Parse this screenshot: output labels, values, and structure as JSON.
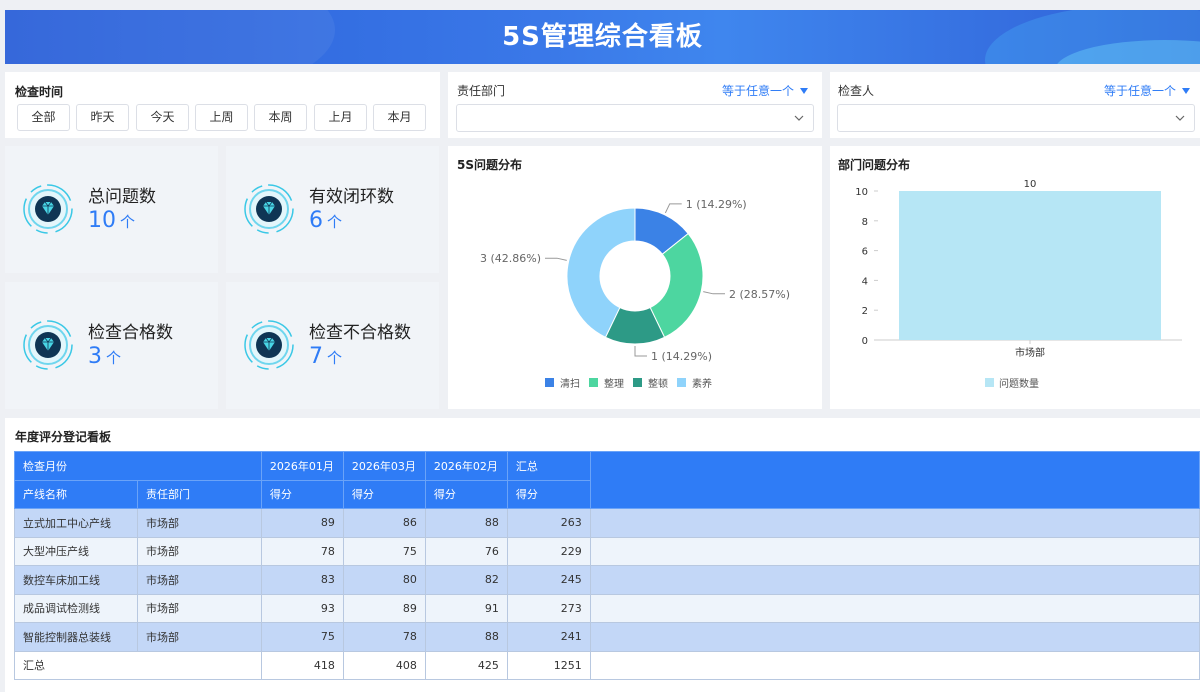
{
  "header": {
    "title": "5S管理综合看板"
  },
  "filters": {
    "time_label": "检查时间",
    "time_buttons": [
      "全部",
      "昨天",
      "今天",
      "上周",
      "本周",
      "上月",
      "本月"
    ],
    "dept_label": "责任部门",
    "dept_mode": "等于任意一个",
    "dept_value": "",
    "inspector_label": "检查人",
    "inspector_mode": "等于任意一个",
    "inspector_value": ""
  },
  "kpis": [
    {
      "label": "总问题数",
      "value": "10",
      "unit": "个"
    },
    {
      "label": "有效闭环数",
      "value": "6",
      "unit": "个"
    },
    {
      "label": "检查合格数",
      "value": "3",
      "unit": "个"
    },
    {
      "label": "检查不合格数",
      "value": "7",
      "unit": "个"
    }
  ],
  "colors": {
    "accent": "#2f7cf6",
    "header": "#3a78e8"
  },
  "chart_data": [
    {
      "type": "pie",
      "title": "5S问题分布",
      "donut": true,
      "slices": [
        {
          "name": "清扫",
          "value": 1,
          "label": "1 (14.29%)",
          "color": "#3b82e6"
        },
        {
          "name": "整理",
          "value": 2,
          "label": "2 (28.57%)",
          "color": "#4dd6a0"
        },
        {
          "name": "整顿",
          "value": 1,
          "label": "1 (14.29%)",
          "color": "#2d9a86"
        },
        {
          "name": "素养",
          "value": 3,
          "label": "3 (42.86%)",
          "color": "#8fd3fb"
        }
      ],
      "legend": "bottom"
    },
    {
      "type": "bar",
      "title": "部门问题分布",
      "categories": [
        "市场部"
      ],
      "series": [
        {
          "name": "问题数量",
          "values": [
            10
          ],
          "color": "#b6e6f5"
        }
      ],
      "ylim": [
        0,
        10
      ],
      "yticks": [
        "0",
        "2",
        "4",
        "6",
        "8",
        "10"
      ],
      "data_labels": [
        "10"
      ],
      "legend": "bottom"
    }
  ],
  "table": {
    "title": "年度评分登记看板",
    "header1": [
      "检查月份",
      "2026年01月",
      "2026年03月",
      "2026年02月",
      "汇总"
    ],
    "header2": [
      "产线名称",
      "责任部门",
      "得分",
      "得分",
      "得分",
      "得分"
    ],
    "rows": [
      [
        "立式加工中心产线",
        "市场部",
        "89",
        "86",
        "88",
        "263"
      ],
      [
        "大型冲压产线",
        "市场部",
        "78",
        "75",
        "76",
        "229"
      ],
      [
        "数控车床加工线",
        "市场部",
        "83",
        "80",
        "82",
        "245"
      ],
      [
        "成品调试检测线",
        "市场部",
        "93",
        "89",
        "91",
        "273"
      ],
      [
        "智能控制器总装线",
        "市场部",
        "75",
        "78",
        "88",
        "241"
      ]
    ],
    "total": [
      "汇总",
      "418",
      "408",
      "425",
      "1251"
    ]
  }
}
